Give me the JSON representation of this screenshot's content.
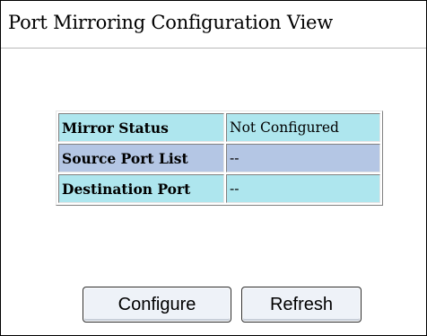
{
  "page": {
    "title": "Port Mirroring Configuration View"
  },
  "table": {
    "rows": [
      {
        "label": "Mirror Status",
        "value": "Not Configured"
      },
      {
        "label": "Source Port List",
        "value": "--"
      },
      {
        "label": "Destination Port",
        "value": "--"
      }
    ]
  },
  "buttons": {
    "configure_label": "Configure",
    "refresh_label": "Refresh"
  },
  "colors": {
    "row_cyan": "#aee6ee",
    "row_blue": "#b4c6e4"
  }
}
